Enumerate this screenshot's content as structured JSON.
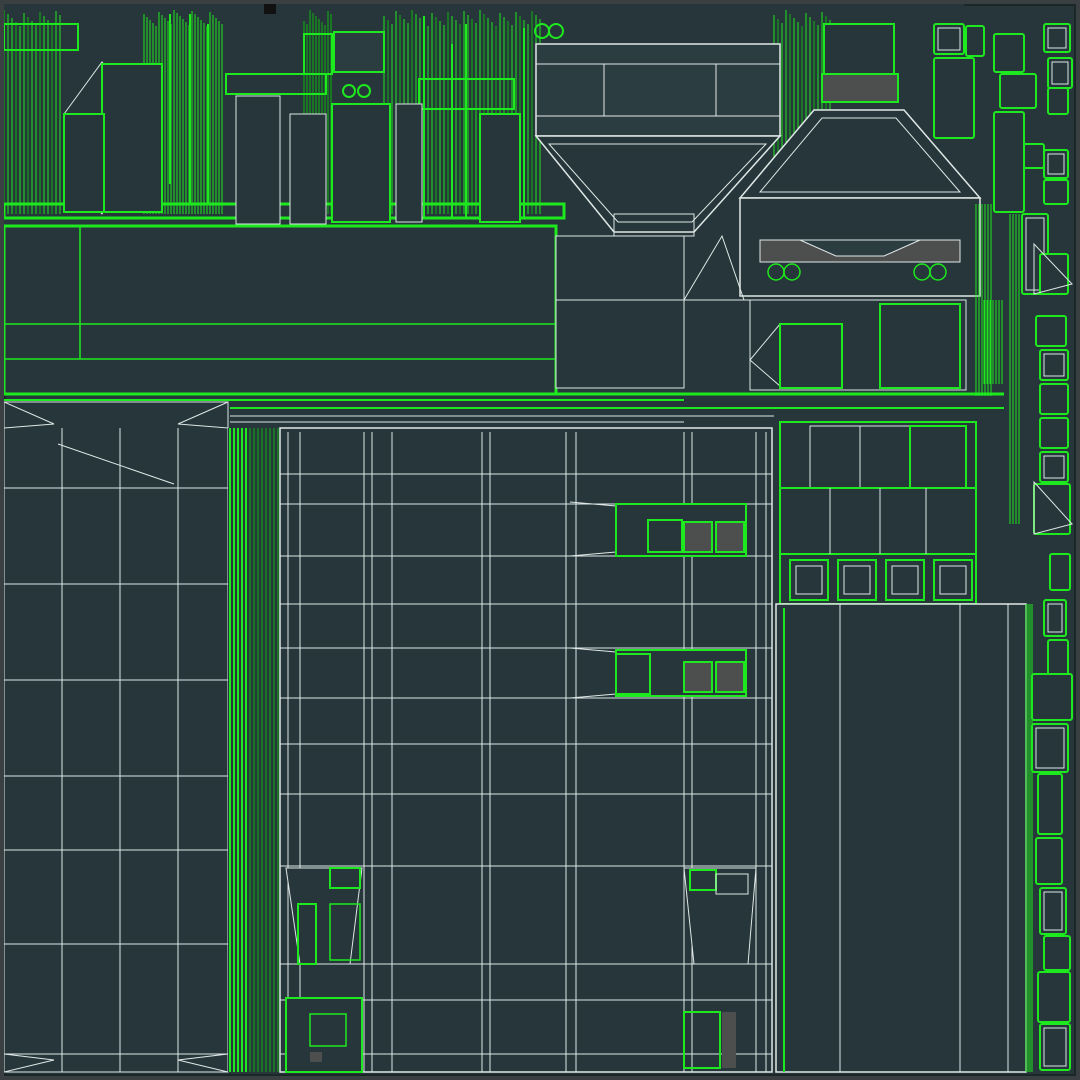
{
  "colors": {
    "viewport_background": "#3a3f42",
    "texture_fill": "#26363a",
    "texture_fill_alt": "#2c3d42",
    "seam_green": "#1ee81e",
    "seam_green_dim": "#0fb50f",
    "edge_white": "#dfe8e6",
    "hole_grey": "#4d4f4f"
  },
  "sheet": {
    "kind": "uv-layout-texture",
    "visible_text": []
  },
  "islands": [
    "header-strip-cluster",
    "top-left-wall-strip",
    "hopper-funnel-shell",
    "roof-pyramid-shell",
    "right-small-panel-column",
    "left-wall-panel",
    "main-facade-grid",
    "window-frame-islands",
    "right-column-panel",
    "right-grid-block",
    "bottom-detail-islands"
  ]
}
